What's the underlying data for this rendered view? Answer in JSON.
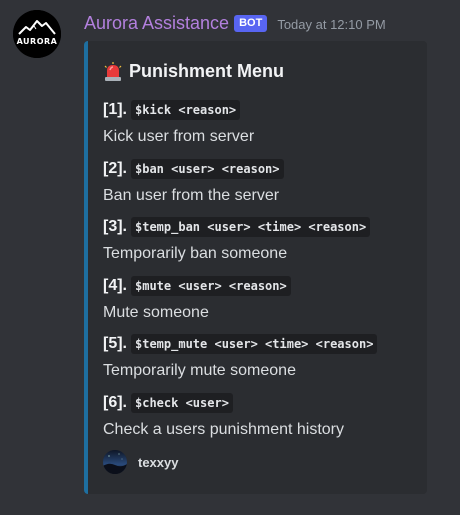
{
  "author": {
    "name": "Aurora Assistance",
    "bot_tag": "BOT",
    "timestamp": "Today at 12:10 PM",
    "avatar_text": "AURORA"
  },
  "colors": {
    "username": "#b380de",
    "bot_tag": "#5865f2",
    "embed_border": "#1e6fa0",
    "background": "#313338",
    "embed_background": "#2b2d31"
  },
  "embed": {
    "title_icon": "siren-icon",
    "title": "Punishment Menu",
    "commands": [
      {
        "number": "[1].",
        "command": "$kick <reason>",
        "description": "Kick user from server"
      },
      {
        "number": "[2].",
        "command": "$ban <user> <reason>",
        "description": "Ban user from the server"
      },
      {
        "number": "[3].",
        "command": "$temp_ban <user> <time> <reason>",
        "description": "Temporarily ban someone"
      },
      {
        "number": "[4].",
        "command": "$mute <user> <reason>",
        "description": "Mute someone"
      },
      {
        "number": "[5].",
        "command": "$temp_mute <user> <time> <reason>",
        "description": "Temporarily mute someone"
      },
      {
        "number": "[6].",
        "command": "$check <user>",
        "description": "Check a users punishment history"
      }
    ],
    "footer": {
      "text": "texxyy"
    }
  }
}
